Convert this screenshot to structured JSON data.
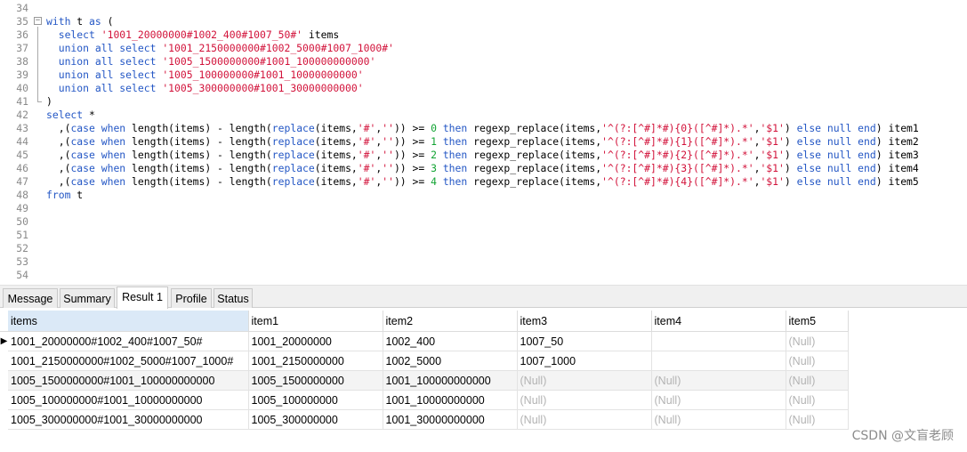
{
  "editor": {
    "lines": [
      {
        "n": "34",
        "segs": []
      },
      {
        "n": "35",
        "fold": "−",
        "segs": [
          {
            "t": "with",
            "c": "kw"
          },
          {
            "t": " t "
          },
          {
            "t": "as",
            "c": "kw"
          },
          {
            "t": " ("
          }
        ]
      },
      {
        "n": "36",
        "segs": [
          {
            "t": "  "
          },
          {
            "t": "select",
            "c": "kw"
          },
          {
            "t": " "
          },
          {
            "t": "'1001_20000000#1002_400#1007_50#'",
            "c": "str"
          },
          {
            "t": " items"
          }
        ]
      },
      {
        "n": "37",
        "segs": [
          {
            "t": "  "
          },
          {
            "t": "union all select",
            "c": "kw"
          },
          {
            "t": " "
          },
          {
            "t": "'1001_2150000000#1002_5000#1007_1000#'",
            "c": "str"
          }
        ]
      },
      {
        "n": "38",
        "segs": [
          {
            "t": "  "
          },
          {
            "t": "union all select",
            "c": "kw"
          },
          {
            "t": " "
          },
          {
            "t": "'1005_1500000000#1001_100000000000'",
            "c": "str"
          }
        ]
      },
      {
        "n": "39",
        "segs": [
          {
            "t": "  "
          },
          {
            "t": "union all select",
            "c": "kw"
          },
          {
            "t": " "
          },
          {
            "t": "'1005_100000000#1001_10000000000'",
            "c": "str"
          }
        ]
      },
      {
        "n": "40",
        "segs": [
          {
            "t": "  "
          },
          {
            "t": "union all select",
            "c": "kw"
          },
          {
            "t": " "
          },
          {
            "t": "'1005_300000000#1001_30000000000'",
            "c": "str"
          }
        ]
      },
      {
        "n": "41",
        "segs": [
          {
            "t": ")"
          }
        ]
      },
      {
        "n": "42",
        "segs": [
          {
            "t": "select",
            "c": "kw"
          },
          {
            "t": " *"
          }
        ]
      },
      {
        "n": "43",
        "segs": [
          {
            "t": "  ,("
          },
          {
            "t": "case when",
            "c": "kw"
          },
          {
            "t": " length(items) - length("
          },
          {
            "t": "replace",
            "c": "kw"
          },
          {
            "t": "(items,"
          },
          {
            "t": "'#'",
            "c": "str"
          },
          {
            "t": ","
          },
          {
            "t": "''",
            "c": "str"
          },
          {
            "t": ")) >= "
          },
          {
            "t": "0",
            "c": "num"
          },
          {
            "t": " "
          },
          {
            "t": "then",
            "c": "kw"
          },
          {
            "t": " regexp_replace(items,"
          },
          {
            "t": "'^(?:[^#]*#){0}([^#]*).*'",
            "c": "str"
          },
          {
            "t": ","
          },
          {
            "t": "'$1'",
            "c": "str"
          },
          {
            "t": ") "
          },
          {
            "t": "else null end",
            "c": "kw"
          },
          {
            "t": ") item1"
          }
        ]
      },
      {
        "n": "44",
        "segs": [
          {
            "t": "  ,("
          },
          {
            "t": "case when",
            "c": "kw"
          },
          {
            "t": " length(items) - length("
          },
          {
            "t": "replace",
            "c": "kw"
          },
          {
            "t": "(items,"
          },
          {
            "t": "'#'",
            "c": "str"
          },
          {
            "t": ","
          },
          {
            "t": "''",
            "c": "str"
          },
          {
            "t": ")) >= "
          },
          {
            "t": "1",
            "c": "num"
          },
          {
            "t": " "
          },
          {
            "t": "then",
            "c": "kw"
          },
          {
            "t": " regexp_replace(items,"
          },
          {
            "t": "'^(?:[^#]*#){1}([^#]*).*'",
            "c": "str"
          },
          {
            "t": ","
          },
          {
            "t": "'$1'",
            "c": "str"
          },
          {
            "t": ") "
          },
          {
            "t": "else null end",
            "c": "kw"
          },
          {
            "t": ") item2"
          }
        ]
      },
      {
        "n": "45",
        "segs": [
          {
            "t": "  ,("
          },
          {
            "t": "case when",
            "c": "kw"
          },
          {
            "t": " length(items) - length("
          },
          {
            "t": "replace",
            "c": "kw"
          },
          {
            "t": "(items,"
          },
          {
            "t": "'#'",
            "c": "str"
          },
          {
            "t": ","
          },
          {
            "t": "''",
            "c": "str"
          },
          {
            "t": ")) >= "
          },
          {
            "t": "2",
            "c": "num"
          },
          {
            "t": " "
          },
          {
            "t": "then",
            "c": "kw"
          },
          {
            "t": " regexp_replace(items,"
          },
          {
            "t": "'^(?:[^#]*#){2}([^#]*).*'",
            "c": "str"
          },
          {
            "t": ","
          },
          {
            "t": "'$1'",
            "c": "str"
          },
          {
            "t": ") "
          },
          {
            "t": "else null end",
            "c": "kw"
          },
          {
            "t": ") item3"
          }
        ]
      },
      {
        "n": "46",
        "segs": [
          {
            "t": "  ,("
          },
          {
            "t": "case when",
            "c": "kw"
          },
          {
            "t": " length(items) - length("
          },
          {
            "t": "replace",
            "c": "kw"
          },
          {
            "t": "(items,"
          },
          {
            "t": "'#'",
            "c": "str"
          },
          {
            "t": ","
          },
          {
            "t": "''",
            "c": "str"
          },
          {
            "t": ")) >= "
          },
          {
            "t": "3",
            "c": "num"
          },
          {
            "t": " "
          },
          {
            "t": "then",
            "c": "kw"
          },
          {
            "t": " regexp_replace(items,"
          },
          {
            "t": "'^(?:[^#]*#){3}([^#]*).*'",
            "c": "str"
          },
          {
            "t": ","
          },
          {
            "t": "'$1'",
            "c": "str"
          },
          {
            "t": ") "
          },
          {
            "t": "else null end",
            "c": "kw"
          },
          {
            "t": ") item4"
          }
        ]
      },
      {
        "n": "47",
        "segs": [
          {
            "t": "  ,("
          },
          {
            "t": "case when",
            "c": "kw"
          },
          {
            "t": " length(items) - length("
          },
          {
            "t": "replace",
            "c": "kw"
          },
          {
            "t": "(items,"
          },
          {
            "t": "'#'",
            "c": "str"
          },
          {
            "t": ","
          },
          {
            "t": "''",
            "c": "str"
          },
          {
            "t": ")) >= "
          },
          {
            "t": "4",
            "c": "num"
          },
          {
            "t": " "
          },
          {
            "t": "then",
            "c": "kw"
          },
          {
            "t": " regexp_replace(items,"
          },
          {
            "t": "'^(?:[^#]*#){4}([^#]*).*'",
            "c": "str"
          },
          {
            "t": ","
          },
          {
            "t": "'$1'",
            "c": "str"
          },
          {
            "t": ") "
          },
          {
            "t": "else null end",
            "c": "kw"
          },
          {
            "t": ") item5"
          }
        ]
      },
      {
        "n": "48",
        "segs": [
          {
            "t": "from",
            "c": "kw"
          },
          {
            "t": " t"
          }
        ]
      },
      {
        "n": "49",
        "segs": []
      },
      {
        "n": "50",
        "segs": []
      },
      {
        "n": "51",
        "segs": []
      },
      {
        "n": "52",
        "segs": []
      },
      {
        "n": "53",
        "segs": []
      },
      {
        "n": "54",
        "segs": []
      }
    ]
  },
  "tabs": [
    {
      "label": "Message"
    },
    {
      "label": "Summary"
    },
    {
      "label": "Result 1",
      "active": true
    },
    {
      "label": "Profile"
    },
    {
      "label": "Status"
    }
  ],
  "grid": {
    "columns": [
      "items",
      "item1",
      "item2",
      "item3",
      "item4",
      "item5"
    ],
    "rows": [
      [
        "1001_20000000#1002_400#1007_50#",
        "1001_20000000",
        "1002_400",
        "1007_50",
        "",
        null
      ],
      [
        "1001_2150000000#1002_5000#1007_1000#",
        "1001_2150000000",
        "1002_5000",
        "1007_1000",
        "",
        null
      ],
      [
        "1005_1500000000#1001_100000000000",
        "1005_1500000000",
        "1001_100000000000",
        null,
        null,
        null
      ],
      [
        "1005_100000000#1001_10000000000",
        "1005_100000000",
        "1001_10000000000",
        null,
        null,
        null
      ],
      [
        "1005_300000000#1001_30000000000",
        "1005_300000000",
        "1001_30000000000",
        null,
        null,
        null
      ]
    ],
    "null_text": "(Null)",
    "current_row_marker": "▶"
  },
  "watermark": "CSDN @文盲老顾"
}
